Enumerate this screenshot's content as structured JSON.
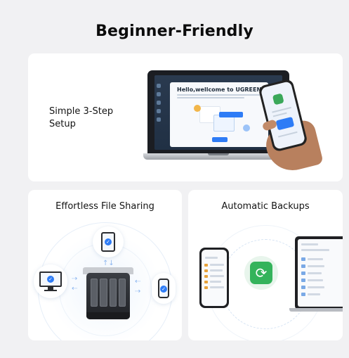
{
  "page": {
    "title": "Beginner-Friendly"
  },
  "setup_card": {
    "label_line1": "Simple 3-Step",
    "label_line2": "Setup",
    "screen_welcome": "Hello,wellcome to UGREEN NAS"
  },
  "sharing_card": {
    "title": "Effortless File Sharing"
  },
  "backup_card": {
    "title": "Automatic Backups"
  },
  "icons": {
    "check": "check-icon",
    "sync": "sync-icon",
    "arrow": "arrow-icon"
  },
  "colors": {
    "background": "#f1f1f3",
    "card": "#ffffff",
    "accent_blue": "#2e7cf6",
    "accent_green": "#34b35b"
  }
}
